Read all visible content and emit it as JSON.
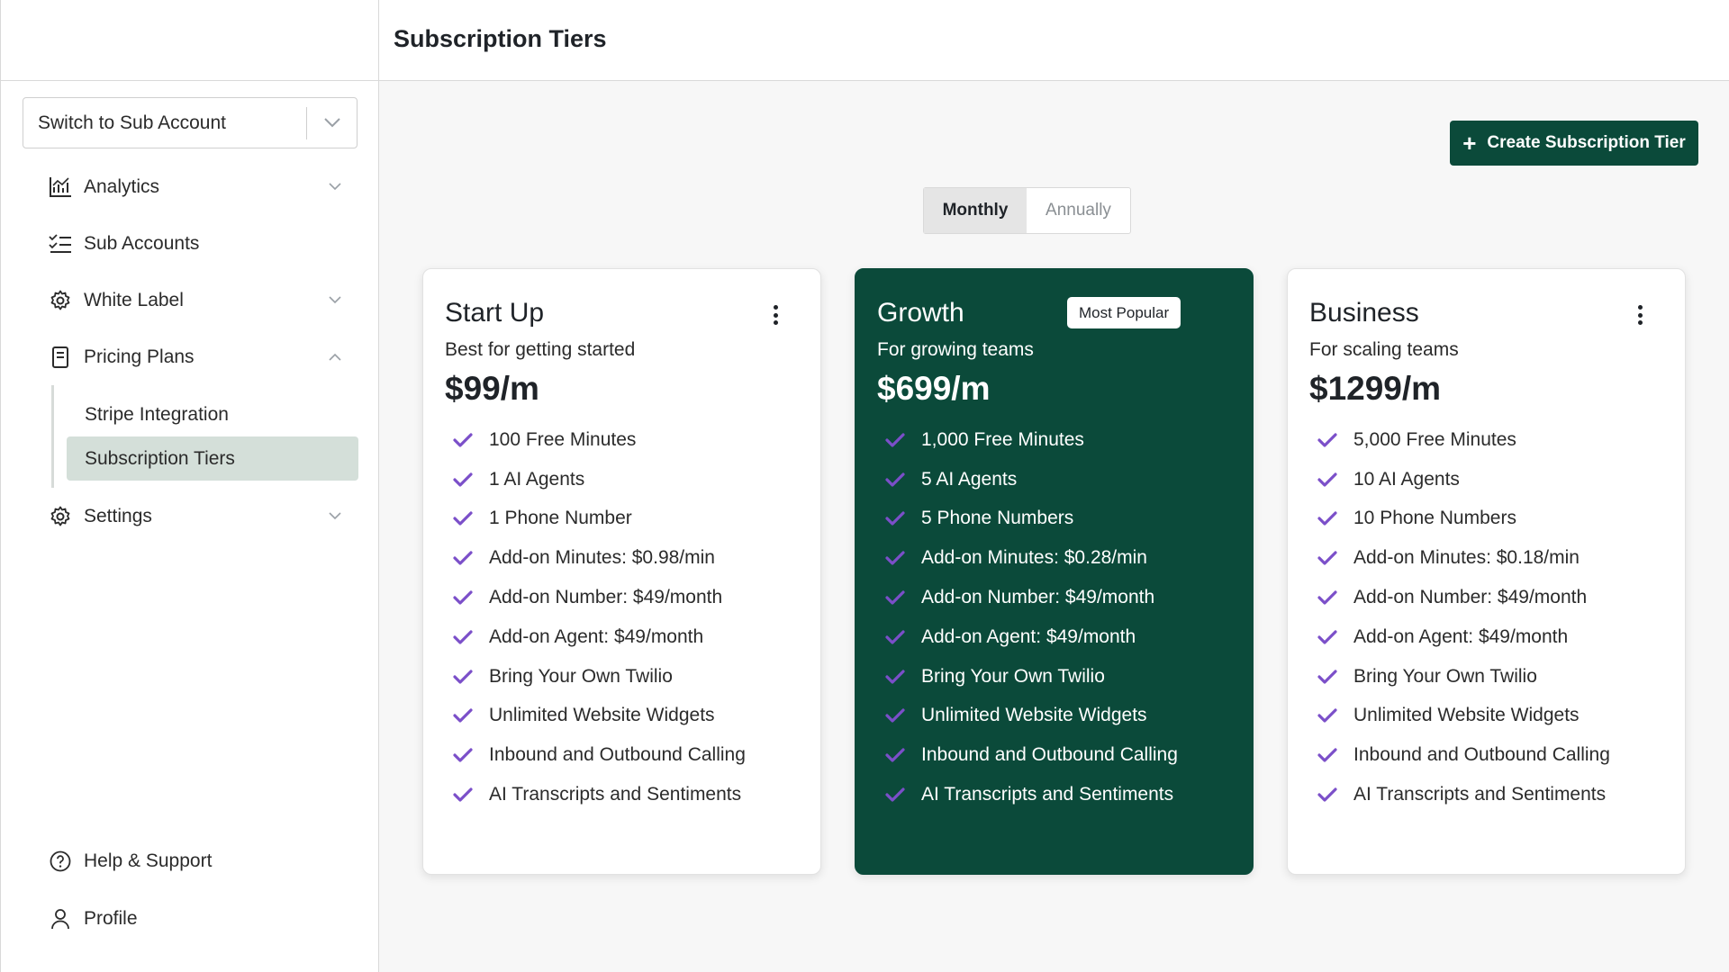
{
  "header": {
    "title": "Subscription Tiers"
  },
  "sidebar": {
    "account_switch": {
      "label": "Switch to Sub Account"
    },
    "items": [
      {
        "label": "Analytics",
        "icon": "bar-chart-icon"
      },
      {
        "label": "Sub Accounts",
        "icon": "checklist-icon"
      },
      {
        "label": "White Label",
        "icon": "gear-icon"
      },
      {
        "label": "Pricing Plans",
        "icon": "document-icon"
      },
      {
        "label": "Settings",
        "icon": "gear-icon"
      }
    ],
    "pricing_subitems": [
      {
        "label": "Stripe Integration"
      },
      {
        "label": "Subscription Tiers"
      }
    ],
    "bottom": [
      {
        "label": "Help & Support",
        "icon": "help-circle-icon"
      },
      {
        "label": "Profile",
        "icon": "user-icon"
      }
    ]
  },
  "toolbar": {
    "create_label": "Create Subscription Tier"
  },
  "billing_toggle": {
    "monthly": "Monthly",
    "annually": "Annually",
    "selected": "Monthly"
  },
  "tiers": [
    {
      "name": "Start Up",
      "description": "Best for getting started",
      "price": "$99/m",
      "features": [
        "100 Free Minutes",
        "1 AI Agents",
        "1 Phone Number",
        "Add-on Minutes: $0.98/min",
        "Add-on Number: $49/month",
        "Add-on Agent: $49/month",
        "Bring Your Own Twilio",
        "Unlimited Website Widgets",
        "Inbound and Outbound Calling",
        "AI Transcripts and Sentiments"
      ]
    },
    {
      "name": "Growth",
      "badge": "Most Popular",
      "description": "For growing teams",
      "price": "$699/m",
      "features": [
        "1,000 Free Minutes",
        "5 AI Agents",
        "5 Phone Numbers",
        "Add-on Minutes: $0.28/min",
        "Add-on Number: $49/month",
        "Add-on Agent: $49/month",
        "Bring Your Own Twilio",
        "Unlimited Website Widgets",
        "Inbound and Outbound Calling",
        "AI Transcripts and Sentiments"
      ]
    },
    {
      "name": "Business",
      "description": "For scaling teams",
      "price": "$1299/m",
      "features": [
        "5,000 Free Minutes",
        "10 AI Agents",
        "10 Phone Numbers",
        "Add-on Minutes: $0.18/min",
        "Add-on Number: $49/month",
        "Add-on Agent: $49/month",
        "Bring Your Own Twilio",
        "Unlimited Website Widgets",
        "Inbound and Outbound Calling",
        "AI Transcripts and Sentiments"
      ]
    }
  ],
  "colors": {
    "brand": "#0b4a3a",
    "check": "#7b4fc9",
    "active_nav": "#d4dfd9"
  }
}
